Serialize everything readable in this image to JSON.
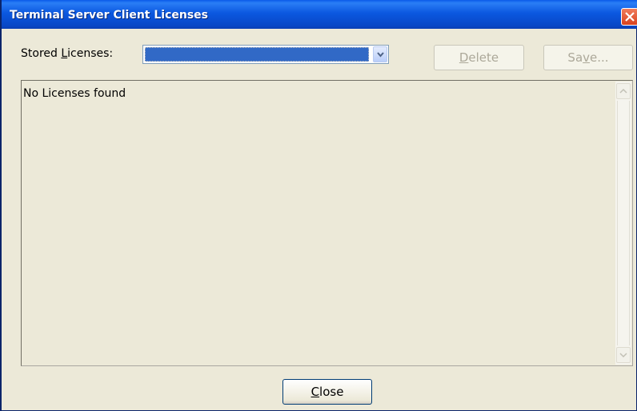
{
  "window": {
    "title": "Terminal Server Client Licenses"
  },
  "stored_licenses": {
    "label_prefix": "Stored ",
    "label_accel": "L",
    "label_suffix": "icenses:",
    "selected_value": ""
  },
  "buttons": {
    "delete": {
      "accel": "D",
      "rest": "elete",
      "enabled": false
    },
    "save": {
      "prefix": "Sa",
      "accel": "v",
      "rest": "e...",
      "enabled": false
    },
    "close": {
      "accel": "C",
      "rest": "lose",
      "enabled": true
    }
  },
  "list": {
    "message": "No Licenses found"
  },
  "colors": {
    "titlebar": "#0b58e0",
    "dialog_bg": "#ece9d8",
    "selection": "#3169c6",
    "disabled_text": "#aca899"
  },
  "icons": {
    "title_close": "close-icon",
    "combo_arrow": "chevron-down-icon",
    "scroll_up": "chevron-up-icon",
    "scroll_down": "chevron-down-icon"
  }
}
